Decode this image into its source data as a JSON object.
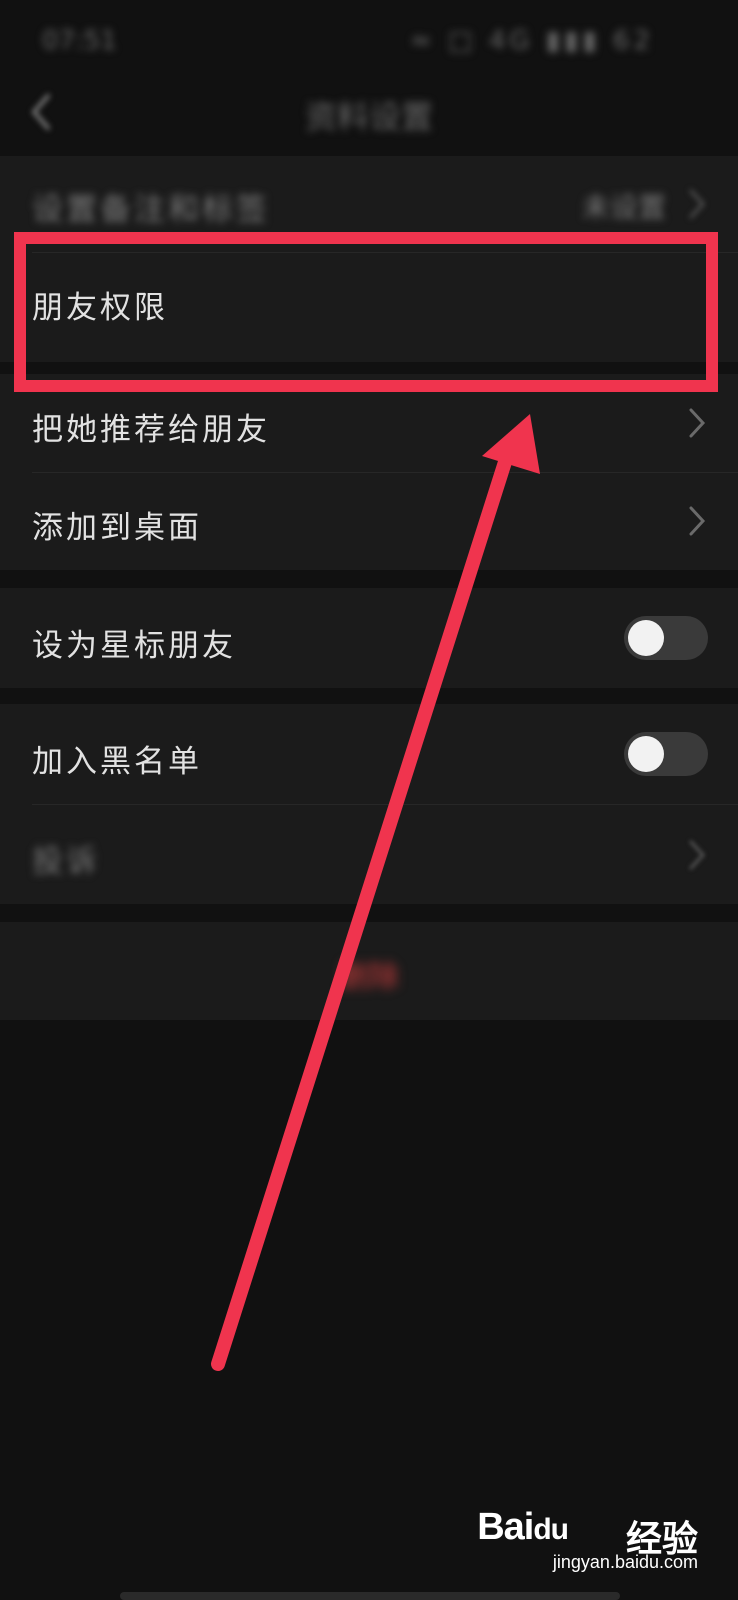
{
  "status_bar": {
    "time": "07:51",
    "icons": "≈ □ 4G ▮▮▮ 62"
  },
  "nav": {
    "title": "资料设置"
  },
  "settings": {
    "remark_label": "设置备注和标签",
    "remark_value": "未设置",
    "friend_permission_label": "朋友权限",
    "recommend_label": "把她推荐给朋友",
    "add_to_desktop_label": "添加到桌面",
    "star_friend_label": "设为星标朋友",
    "star_friend_on": false,
    "blacklist_label": "加入黑名单",
    "blacklist_on": false,
    "complain_label": "投诉"
  },
  "delete_button_label": "删除",
  "watermark": {
    "brand": "Bai",
    "brand_tail": "du",
    "text": "经验",
    "url": "jingyan.baidu.com"
  },
  "colors": {
    "background": "#111111",
    "row_background": "#1b1b1b",
    "highlight": "#f0344e",
    "danger": "#c23b3b"
  },
  "icons": {
    "back": "chevron-left-icon",
    "row_arrow": "chevron-right-icon",
    "annotation": "arrow-up-icon",
    "watermark_paw": "paw-icon"
  }
}
